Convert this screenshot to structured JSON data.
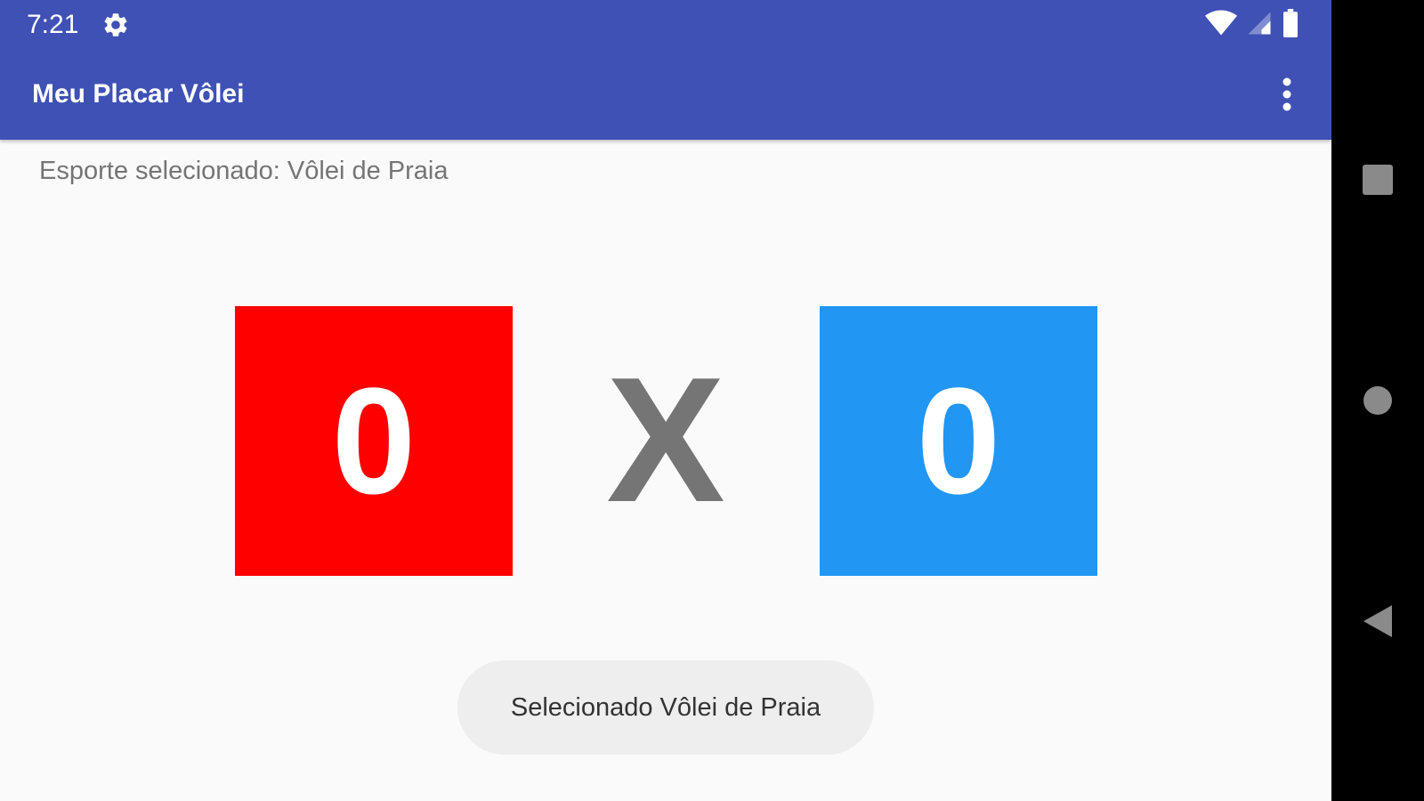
{
  "status_bar": {
    "time": "7:21",
    "icons": [
      "gear-icon",
      "wifi-icon",
      "cell-signal-icon",
      "battery-icon"
    ]
  },
  "app_bar": {
    "title": "Meu Placar Vôlei",
    "menu_icon": "more-vert-icon",
    "color": "#3f51b5"
  },
  "main": {
    "sport_label": "Esporte selecionado: Vôlei de Praia",
    "team_a": {
      "score": "0",
      "color": "#ff0000"
    },
    "team_b": {
      "score": "0",
      "color": "#2196f3"
    },
    "versus": "X"
  },
  "toast": {
    "message": "Selecionado Vôlei de Praia"
  },
  "nav_bar": {
    "buttons": [
      "recents-square-icon",
      "home-circle-icon",
      "back-triangle-icon"
    ]
  }
}
